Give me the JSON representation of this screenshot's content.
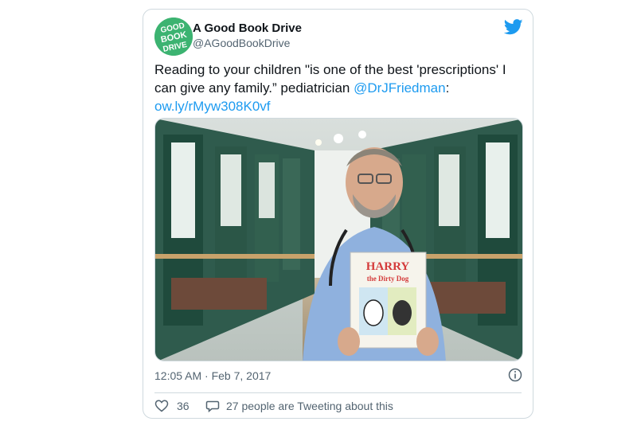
{
  "tweet": {
    "account_name": "A Good Book Drive",
    "handle": "@AGoodBookDrive",
    "avatar_text": [
      "GOOD",
      "BOOK",
      "DRIVE"
    ],
    "text_part1": "Reading to your children \"is one of the best 'prescriptions' I can give any family.” pediatrician ",
    "mention": "@DrJFriedman",
    "text_part2": ": ",
    "link": "ow.ly/rMyw308K0vf",
    "timestamp": "12:05 AM · Feb 7, 2017",
    "like_count": "36",
    "tweeting_about": "27 people are Tweeting about this"
  },
  "media": {
    "book_title_line1": "HARRY",
    "book_title_line2": "the Dirty Dog"
  },
  "colors": {
    "accent": "#1d9bf0",
    "avatar_green": "#3cb371",
    "muted": "#536471"
  },
  "icons": [
    "twitter-bird-icon",
    "info-icon",
    "heart-icon",
    "speech-bubble-icon"
  ]
}
